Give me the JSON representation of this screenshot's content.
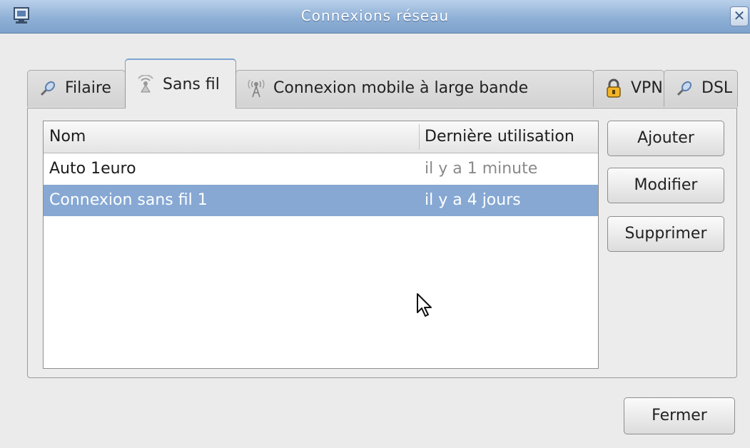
{
  "window": {
    "title": "Connexions réseau",
    "close_symbol": "✕"
  },
  "tabs": [
    {
      "label": "Filaire",
      "icon": "wired-network-icon"
    },
    {
      "label": "Sans fil",
      "icon": "wireless-network-icon",
      "active": true
    },
    {
      "label": "Connexion mobile à large bande",
      "icon": "mobile-broadband-icon"
    },
    {
      "label": "VPN",
      "icon": "vpn-lock-icon"
    },
    {
      "label": "DSL",
      "icon": "dsl-network-icon"
    }
  ],
  "list": {
    "columns": [
      "Nom",
      "Dernière utilisation"
    ],
    "rows": [
      {
        "name": "Auto 1euro",
        "last_used": "il y a 1 minute",
        "selected": false
      },
      {
        "name": "Connexion sans fil 1",
        "last_used": "il y a 4 jours",
        "selected": true
      }
    ]
  },
  "buttons": {
    "add": "Ajouter",
    "edit": "Modifier",
    "delete": "Supprimer",
    "close": "Fermer"
  },
  "colors": {
    "titlebar": "#8fb0d6",
    "selection": "#86a8d3"
  }
}
